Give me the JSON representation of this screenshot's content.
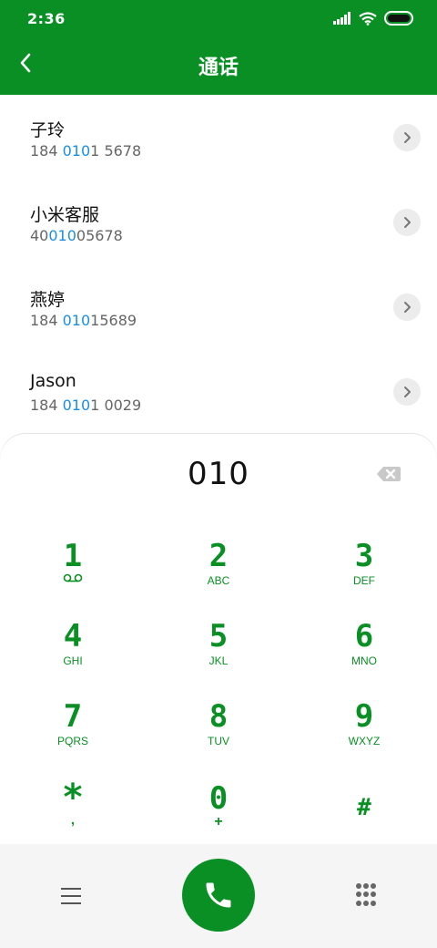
{
  "status_bar": {
    "time": "2:36"
  },
  "header": {
    "title": "通话"
  },
  "contacts": [
    {
      "name": "子玲",
      "number_pre": "184 ",
      "number_match": "010",
      "number_post": "1 5678"
    },
    {
      "name": "小米客服",
      "number_pre": "40",
      "number_match": "010",
      "number_post": "05678"
    },
    {
      "name": "燕婷",
      "number_pre": "184 ",
      "number_match": "010",
      "number_post": "15689"
    },
    {
      "name": "Jason",
      "number_pre": "184 ",
      "number_match": "010",
      "number_post": "1 0029"
    }
  ],
  "dialpad": {
    "entered": "010",
    "keys": [
      {
        "digit": "1",
        "letters": ""
      },
      {
        "digit": "2",
        "letters": "ABC"
      },
      {
        "digit": "3",
        "letters": "DEF"
      },
      {
        "digit": "4",
        "letters": "GHI"
      },
      {
        "digit": "5",
        "letters": "JKL"
      },
      {
        "digit": "6",
        "letters": "MNO"
      },
      {
        "digit": "7",
        "letters": "PQRS"
      },
      {
        "digit": "8",
        "letters": "TUV"
      },
      {
        "digit": "9",
        "letters": "WXYZ"
      },
      {
        "digit": "*",
        "letters": ","
      },
      {
        "digit": "0",
        "letters": "+"
      },
      {
        "digit": "#",
        "letters": ""
      }
    ]
  },
  "colors": {
    "brand_green": "#0a8f24",
    "match_blue": "#1a8fe0"
  },
  "icons": {
    "back": "back-arrow-icon",
    "contact_detail": "chevron-right-icon",
    "backspace": "backspace-icon",
    "voicemail": "voicemail-icon",
    "menu": "menu-icon",
    "call": "phone-icon",
    "keypad_toggle": "keypad-icon"
  }
}
